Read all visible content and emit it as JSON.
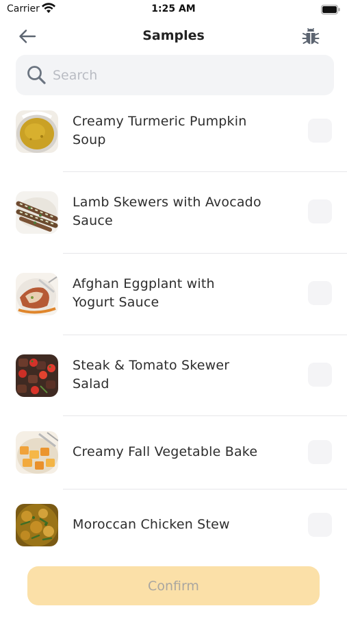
{
  "status_bar": {
    "carrier": "Carrier",
    "time": "1:25 AM"
  },
  "nav": {
    "title": "Samples",
    "back_icon": "arrow-left-icon",
    "action_icon": "bug-icon"
  },
  "search": {
    "placeholder": "Search",
    "value": ""
  },
  "recipes": [
    {
      "title_line1": "Creamy Turmeric Pumpkin",
      "title_line2": "Soup",
      "checked": false,
      "image": "pumpkin-soup"
    },
    {
      "title_line1": "Lamb Skewers with Avocado",
      "title_line2": "Sauce",
      "checked": false,
      "image": "lamb-skewers"
    },
    {
      "title_line1": "Afghan Eggplant with",
      "title_line2": "Yogurt Sauce",
      "checked": false,
      "image": "eggplant"
    },
    {
      "title_line1": "Steak & Tomato Skewer",
      "title_line2": "Salad",
      "checked": false,
      "image": "steak-salad"
    },
    {
      "title_line1": "Creamy Fall Vegetable Bake",
      "title_line2": "",
      "checked": false,
      "image": "vegetable-bake"
    },
    {
      "title_line1": "Moroccan Chicken Stew",
      "title_line2": "",
      "checked": false,
      "image": "chicken-stew"
    }
  ],
  "confirm": {
    "label": "Confirm",
    "enabled": false
  },
  "colors": {
    "accent_disabled": "#fbe0a8",
    "search_bg": "#f3f4f6",
    "checkbox_bg": "#f4f4f6"
  }
}
